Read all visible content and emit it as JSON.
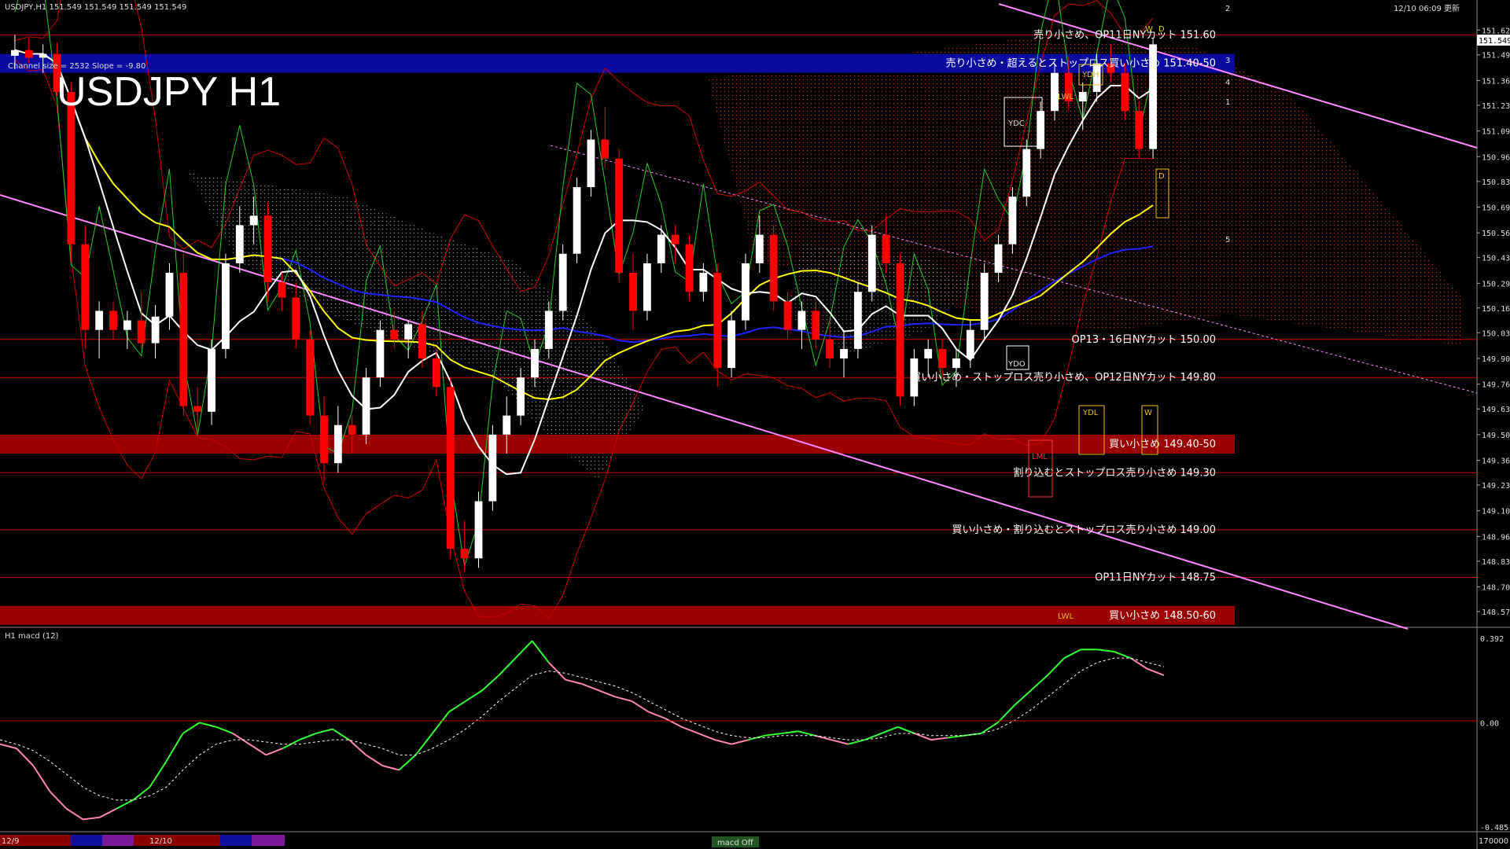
{
  "header": {
    "symbol_info": "USDJPY,H1 151.549 151.549 151.549 151.549",
    "channel_info": "Channel size = 2532 Slope = -9.80",
    "big_title": "USDJPY H1",
    "timestamp": "12/10 06:09 更新",
    "price_badge": "151.549"
  },
  "colors": {
    "background": "#000000",
    "bull_candle": "#ffffff",
    "bear_candle": "#ff0000",
    "zone_blue": "#0a0aa0",
    "zone_red": "#9a0000",
    "channel_line": "#ff88ff",
    "ma_white": "#ffffff",
    "ma_yellow": "#ffff00",
    "ma_blue": "#2222ff",
    "macd_main_up": "#33ff33",
    "macd_main_down": "#ff88aa",
    "macd_signal": "#ffffff"
  },
  "chart_data": [
    {
      "type": "candlestick",
      "title": "USDJPY H1",
      "ylim": [
        148.5,
        151.75
      ],
      "y_ticks": [
        "151.625",
        "151.495",
        "151.360",
        "151.230",
        "151.095",
        "150.960",
        "150.830",
        "150.695",
        "150.560",
        "150.430",
        "150.295",
        "150.165",
        "150.035",
        "149.900",
        "149.765",
        "149.635",
        "149.500",
        "149.365",
        "149.235",
        "149.100",
        "148.965",
        "148.835",
        "148.700",
        "148.570"
      ],
      "candles": [
        {
          "o": 151.49,
          "h": 151.6,
          "l": 151.42,
          "c": 151.52
        },
        {
          "o": 151.52,
          "h": 151.58,
          "l": 151.45,
          "c": 151.48
        },
        {
          "o": 151.48,
          "h": 151.55,
          "l": 151.4,
          "c": 151.5
        },
        {
          "o": 151.5,
          "h": 151.56,
          "l": 151.28,
          "c": 151.3
        },
        {
          "o": 151.3,
          "h": 151.35,
          "l": 150.4,
          "c": 150.5
        },
        {
          "o": 150.5,
          "h": 150.6,
          "l": 149.95,
          "c": 150.05
        },
        {
          "o": 150.05,
          "h": 150.2,
          "l": 149.9,
          "c": 150.15
        },
        {
          "o": 150.15,
          "h": 150.2,
          "l": 150.0,
          "c": 150.05
        },
        {
          "o": 150.05,
          "h": 150.15,
          "l": 149.95,
          "c": 150.1
        },
        {
          "o": 150.1,
          "h": 150.25,
          "l": 149.95,
          "c": 149.98
        },
        {
          "o": 149.98,
          "h": 150.18,
          "l": 149.9,
          "c": 150.12
        },
        {
          "o": 150.12,
          "h": 150.4,
          "l": 150.05,
          "c": 150.35
        },
        {
          "o": 150.35,
          "h": 150.45,
          "l": 149.6,
          "c": 149.65
        },
        {
          "o": 149.65,
          "h": 149.75,
          "l": 149.5,
          "c": 149.62
        },
        {
          "o": 149.62,
          "h": 150.0,
          "l": 149.55,
          "c": 149.95
        },
        {
          "o": 149.95,
          "h": 150.45,
          "l": 149.9,
          "c": 150.4
        },
        {
          "o": 150.4,
          "h": 150.7,
          "l": 150.35,
          "c": 150.6
        },
        {
          "o": 150.6,
          "h": 150.75,
          "l": 150.5,
          "c": 150.65
        },
        {
          "o": 150.65,
          "h": 150.72,
          "l": 150.2,
          "c": 150.3
        },
        {
          "o": 150.3,
          "h": 150.35,
          "l": 150.15,
          "c": 150.22
        },
        {
          "o": 150.22,
          "h": 150.3,
          "l": 149.95,
          "c": 150.0
        },
        {
          "o": 150.0,
          "h": 150.05,
          "l": 149.55,
          "c": 149.6
        },
        {
          "o": 149.6,
          "h": 149.7,
          "l": 149.25,
          "c": 149.35
        },
        {
          "o": 149.35,
          "h": 149.65,
          "l": 149.3,
          "c": 149.55
        },
        {
          "o": 149.55,
          "h": 149.6,
          "l": 149.4,
          "c": 149.5
        },
        {
          "o": 149.5,
          "h": 149.85,
          "l": 149.45,
          "c": 149.8
        },
        {
          "o": 149.8,
          "h": 150.1,
          "l": 149.75,
          "c": 150.05
        },
        {
          "o": 150.05,
          "h": 150.15,
          "l": 149.95,
          "c": 150.0
        },
        {
          "o": 150.0,
          "h": 150.1,
          "l": 149.9,
          "c": 150.08
        },
        {
          "o": 150.08,
          "h": 150.15,
          "l": 149.85,
          "c": 149.9
        },
        {
          "o": 149.9,
          "h": 149.95,
          "l": 149.7,
          "c": 149.75
        },
        {
          "o": 149.75,
          "h": 149.8,
          "l": 148.85,
          "c": 148.9
        },
        {
          "o": 148.9,
          "h": 149.05,
          "l": 148.78,
          "c": 148.85
        },
        {
          "o": 148.85,
          "h": 149.2,
          "l": 148.8,
          "c": 149.15
        },
        {
          "o": 149.15,
          "h": 149.55,
          "l": 149.1,
          "c": 149.5
        },
        {
          "o": 149.5,
          "h": 149.7,
          "l": 149.4,
          "c": 149.6
        },
        {
          "o": 149.6,
          "h": 149.85,
          "l": 149.55,
          "c": 149.8
        },
        {
          "o": 149.8,
          "h": 150.0,
          "l": 149.75,
          "c": 149.95
        },
        {
          "o": 149.95,
          "h": 150.2,
          "l": 149.9,
          "c": 150.15
        },
        {
          "o": 150.15,
          "h": 150.5,
          "l": 150.1,
          "c": 150.45
        },
        {
          "o": 150.45,
          "h": 150.85,
          "l": 150.4,
          "c": 150.8
        },
        {
          "o": 150.8,
          "h": 151.1,
          "l": 150.75,
          "c": 151.05
        },
        {
          "o": 151.05,
          "h": 151.22,
          "l": 150.9,
          "c": 150.95
        },
        {
          "o": 150.95,
          "h": 151.0,
          "l": 150.3,
          "c": 150.35
        },
        {
          "o": 150.35,
          "h": 150.45,
          "l": 150.05,
          "c": 150.15
        },
        {
          "o": 150.15,
          "h": 150.45,
          "l": 150.1,
          "c": 150.4
        },
        {
          "o": 150.4,
          "h": 150.6,
          "l": 150.35,
          "c": 150.55
        },
        {
          "o": 150.55,
          "h": 150.6,
          "l": 150.4,
          "c": 150.5
        },
        {
          "o": 150.5,
          "h": 150.55,
          "l": 150.2,
          "c": 150.25
        },
        {
          "o": 150.25,
          "h": 150.4,
          "l": 150.2,
          "c": 150.35
        },
        {
          "o": 150.35,
          "h": 150.4,
          "l": 149.75,
          "c": 149.85
        },
        {
          "o": 149.85,
          "h": 150.15,
          "l": 149.8,
          "c": 150.1
        },
        {
          "o": 150.1,
          "h": 150.45,
          "l": 150.05,
          "c": 150.4
        },
        {
          "o": 150.4,
          "h": 150.65,
          "l": 150.35,
          "c": 150.55
        },
        {
          "o": 150.55,
          "h": 150.6,
          "l": 150.15,
          "c": 150.2
        },
        {
          "o": 150.2,
          "h": 150.25,
          "l": 150.0,
          "c": 150.05
        },
        {
          "o": 150.05,
          "h": 150.2,
          "l": 149.95,
          "c": 150.15
        },
        {
          "o": 150.15,
          "h": 150.2,
          "l": 149.95,
          "c": 150.0
        },
        {
          "o": 150.0,
          "h": 150.1,
          "l": 149.85,
          "c": 149.9
        },
        {
          "o": 149.9,
          "h": 150.05,
          "l": 149.8,
          "c": 149.95
        },
        {
          "o": 149.95,
          "h": 150.3,
          "l": 149.9,
          "c": 150.25
        },
        {
          "o": 150.25,
          "h": 150.6,
          "l": 150.2,
          "c": 150.55
        },
        {
          "o": 150.55,
          "h": 150.65,
          "l": 150.35,
          "c": 150.4
        },
        {
          "o": 150.4,
          "h": 150.45,
          "l": 149.65,
          "c": 149.7
        },
        {
          "o": 149.7,
          "h": 149.95,
          "l": 149.65,
          "c": 149.9
        },
        {
          "o": 149.9,
          "h": 150.0,
          "l": 149.8,
          "c": 149.95
        },
        {
          "o": 149.95,
          "h": 150.0,
          "l": 149.8,
          "c": 149.85
        },
        {
          "o": 149.85,
          "h": 149.95,
          "l": 149.75,
          "c": 149.9
        },
        {
          "o": 149.9,
          "h": 150.1,
          "l": 149.85,
          "c": 150.05
        },
        {
          "o": 150.05,
          "h": 150.4,
          "l": 150.0,
          "c": 150.35
        },
        {
          "o": 150.35,
          "h": 150.55,
          "l": 150.3,
          "c": 150.5
        },
        {
          "o": 150.5,
          "h": 150.8,
          "l": 150.45,
          "c": 150.75
        },
        {
          "o": 150.75,
          "h": 151.05,
          "l": 150.7,
          "c": 151.0
        },
        {
          "o": 151.0,
          "h": 151.25,
          "l": 150.95,
          "c": 151.2
        },
        {
          "o": 151.2,
          "h": 151.45,
          "l": 151.15,
          "c": 151.4
        },
        {
          "o": 151.4,
          "h": 151.48,
          "l": 151.2,
          "c": 151.25
        },
        {
          "o": 151.25,
          "h": 151.35,
          "l": 151.1,
          "c": 151.3
        },
        {
          "o": 151.3,
          "h": 151.5,
          "l": 151.25,
          "c": 151.45
        },
        {
          "o": 151.45,
          "h": 151.55,
          "l": 151.35,
          "c": 151.4
        },
        {
          "o": 151.4,
          "h": 151.45,
          "l": 151.15,
          "c": 151.2
        },
        {
          "o": 151.2,
          "h": 151.25,
          "l": 150.95,
          "c": 151.0
        },
        {
          "o": 151.0,
          "h": 151.58,
          "l": 150.95,
          "c": 151.55
        }
      ],
      "horizontal_levels": [
        {
          "price": 151.6,
          "label": "売り小さめ、OP11日NYカット 151.60"
        },
        {
          "price": 151.45,
          "label": "売り小さめ・超えるとストップロス買い小さめ 151.40-50",
          "zone": "blue"
        },
        {
          "price": 150.0,
          "label": "OP13・16日NYカット 150.00"
        },
        {
          "price": 149.8,
          "label": "買い小さめ・ストップロス売り小さめ、OP12日NYカット 149.80"
        },
        {
          "price": 149.45,
          "label": "買い小さめ 149.40-50",
          "zone": "red"
        },
        {
          "price": 149.3,
          "label": "割り込むとストップロス売り小さめ 149.30"
        },
        {
          "price": 149.0,
          "label": "買い小さめ・割り込むとストップロス売り小さめ 149.00"
        },
        {
          "price": 148.75,
          "label": "OP11日NYカット 148.75"
        },
        {
          "price": 148.55,
          "label": "買い小さめ 148.50-60",
          "zone": "red"
        }
      ],
      "box_labels": [
        "YDH",
        "YDC",
        "YDO",
        "YDL",
        "LWL",
        "LML",
        "LWL",
        "W",
        "D",
        "D",
        "W"
      ],
      "projection_labels": [
        "2",
        "3",
        "4",
        "1",
        "5"
      ]
    },
    {
      "type": "line",
      "title": "H1 macd (12)",
      "ylim": [
        -0.485,
        0.392
      ],
      "y_ticks": [
        "0.392",
        "0.00",
        "-0.485"
      ],
      "main": [
        -0.1,
        -0.12,
        -0.2,
        -0.32,
        -0.4,
        -0.45,
        -0.44,
        -0.4,
        -0.36,
        -0.3,
        -0.18,
        -0.05,
        0.0,
        -0.02,
        -0.05,
        -0.1,
        -0.15,
        -0.12,
        -0.08,
        -0.05,
        -0.03,
        -0.08,
        -0.15,
        -0.2,
        -0.22,
        -0.15,
        -0.05,
        0.05,
        0.1,
        0.15,
        0.22,
        0.3,
        0.38,
        0.28,
        0.2,
        0.18,
        0.15,
        0.12,
        0.1,
        0.05,
        0.02,
        -0.02,
        -0.05,
        -0.08,
        -0.1,
        -0.08,
        -0.06,
        -0.05,
        -0.04,
        -0.06,
        -0.08,
        -0.1,
        -0.08,
        -0.05,
        -0.02,
        -0.05,
        -0.08,
        -0.07,
        -0.06,
        -0.05,
        0.0,
        0.08,
        0.15,
        0.22,
        0.3,
        0.34,
        0.34,
        0.33,
        0.3,
        0.25,
        0.22
      ],
      "signal": [
        -0.08,
        -0.1,
        -0.13,
        -0.18,
        -0.24,
        -0.3,
        -0.34,
        -0.36,
        -0.36,
        -0.34,
        -0.3,
        -0.22,
        -0.15,
        -0.1,
        -0.08,
        -0.08,
        -0.09,
        -0.1,
        -0.1,
        -0.09,
        -0.08,
        -0.08,
        -0.1,
        -0.12,
        -0.15,
        -0.15,
        -0.12,
        -0.08,
        -0.03,
        0.03,
        0.1,
        0.16,
        0.22,
        0.24,
        0.23,
        0.21,
        0.19,
        0.17,
        0.14,
        0.1,
        0.06,
        0.02,
        -0.01,
        -0.04,
        -0.06,
        -0.07,
        -0.07,
        -0.06,
        -0.06,
        -0.06,
        -0.07,
        -0.08,
        -0.08,
        -0.07,
        -0.05,
        -0.05,
        -0.06,
        -0.06,
        -0.06,
        -0.05,
        -0.03,
        0.01,
        0.06,
        0.12,
        0.18,
        0.24,
        0.28,
        0.3,
        0.3,
        0.28,
        0.26
      ]
    }
  ],
  "timeline": {
    "labels": [
      "12/9",
      "12/10"
    ],
    "indicator_label": "macd Off",
    "right_value": "170000"
  }
}
